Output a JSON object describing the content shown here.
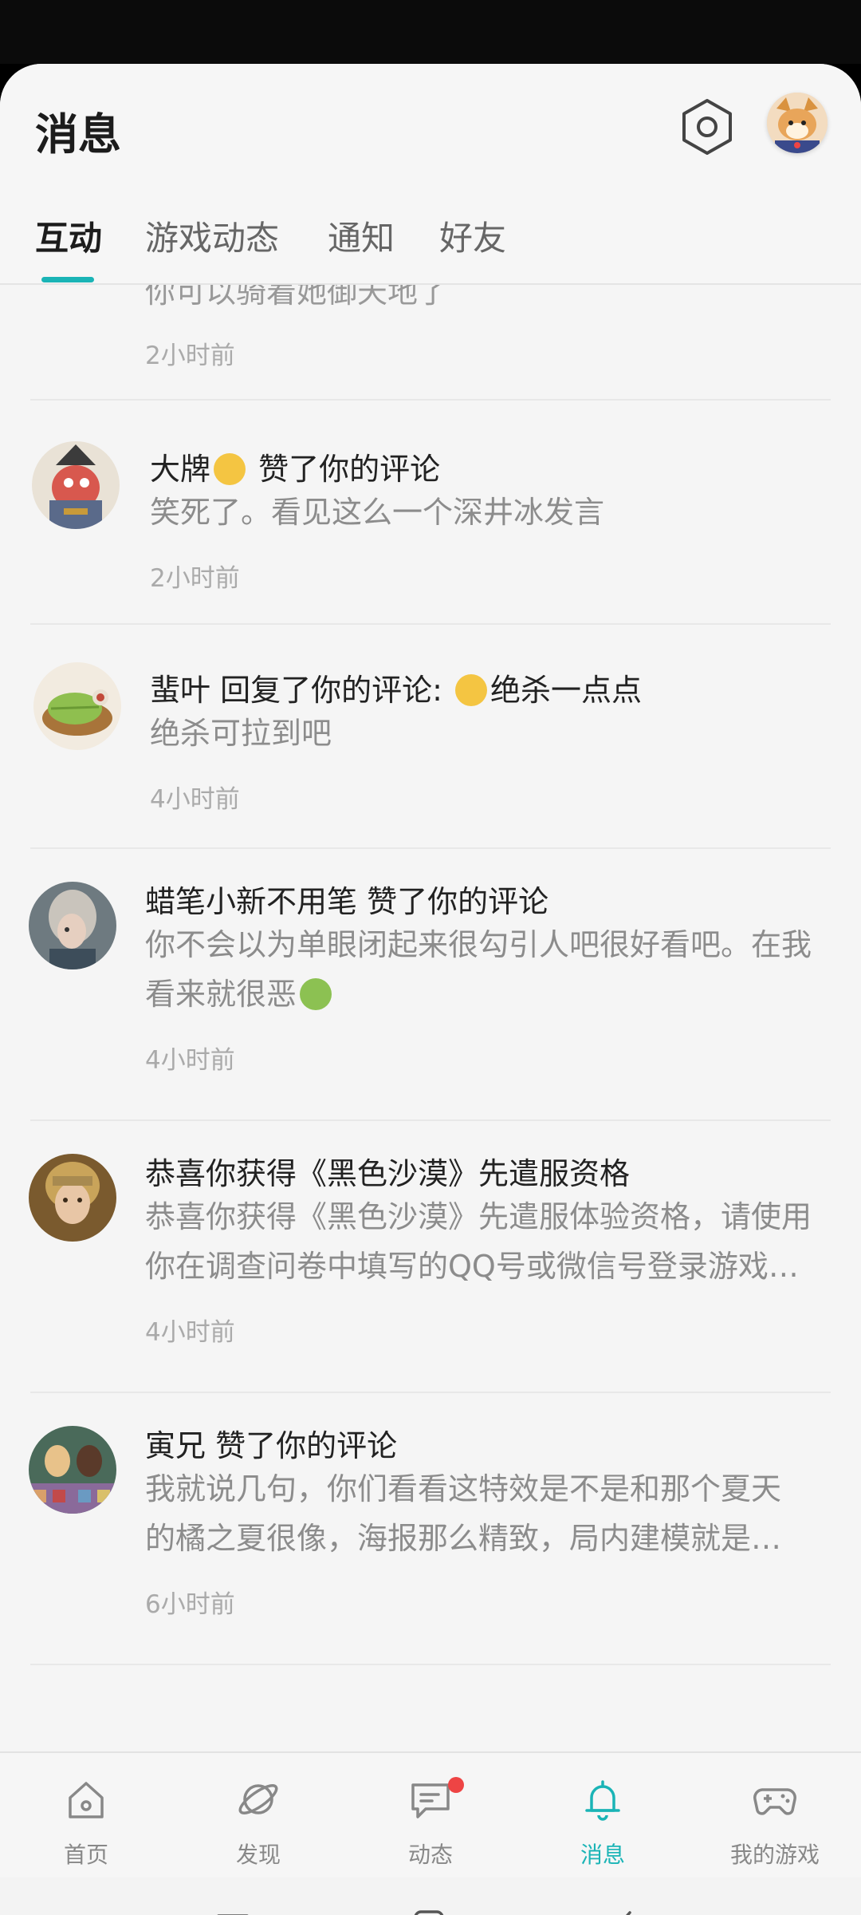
{
  "header": {
    "title": "消息"
  },
  "tabs": [
    {
      "label": "互动",
      "active": true
    },
    {
      "label": "游戏动态"
    },
    {
      "label": "通知"
    },
    {
      "label": "好友"
    }
  ],
  "partial_item": {
    "body": "你可以骑着她御天地了",
    "time": "2小时前"
  },
  "messages": [
    {
      "title_before": "大牌",
      "title_emoji": "victory-hand",
      "title_after": " 赞了你的评论",
      "body": "笑死了。看见这么一个深井冰发言",
      "time": "2小时前"
    },
    {
      "title_before": "蜚叶 回复了你的评论: ",
      "title_emoji": "rolling-laughing-face",
      "title_after": "绝杀一点点",
      "body": "绝杀可拉到吧",
      "time": "4小时前"
    },
    {
      "title": "蜡笔小新不用笔 赞了你的评论",
      "body": "你不会以为单眼闭起来很勾引人吧很好看吧。在我看来就很恶",
      "body_emoji": "nauseated-face",
      "time": "4小时前"
    },
    {
      "title": "恭喜你获得《黑色沙漠》先遣服资格",
      "body": "恭喜你获得《黑色沙漠》先遣服体验资格，请使用你在调查问卷中填写的QQ号或微信号登录游戏体验",
      "time": "4小时前"
    },
    {
      "title": "寅兄 赞了你的评论",
      "body": "我就说几句，你们看看这特效是不是和那个夏天的橘之夏很像，海报那么精致，局内建模就是一般般",
      "time": "6小时前"
    }
  ],
  "bottom_nav": [
    {
      "label": "首页",
      "icon": "home-icon"
    },
    {
      "label": "发现",
      "icon": "planet-icon"
    },
    {
      "label": "动态",
      "icon": "chat-icon",
      "badge": true
    },
    {
      "label": "消息",
      "icon": "bell-icon",
      "active": true
    },
    {
      "label": "我的游戏",
      "icon": "gamepad-icon"
    }
  ],
  "system_nav": [
    "menu-icon",
    "home-square-icon",
    "back-icon"
  ],
  "colors": {
    "accent": "#1ab4b6",
    "badge": "#ee4444"
  }
}
